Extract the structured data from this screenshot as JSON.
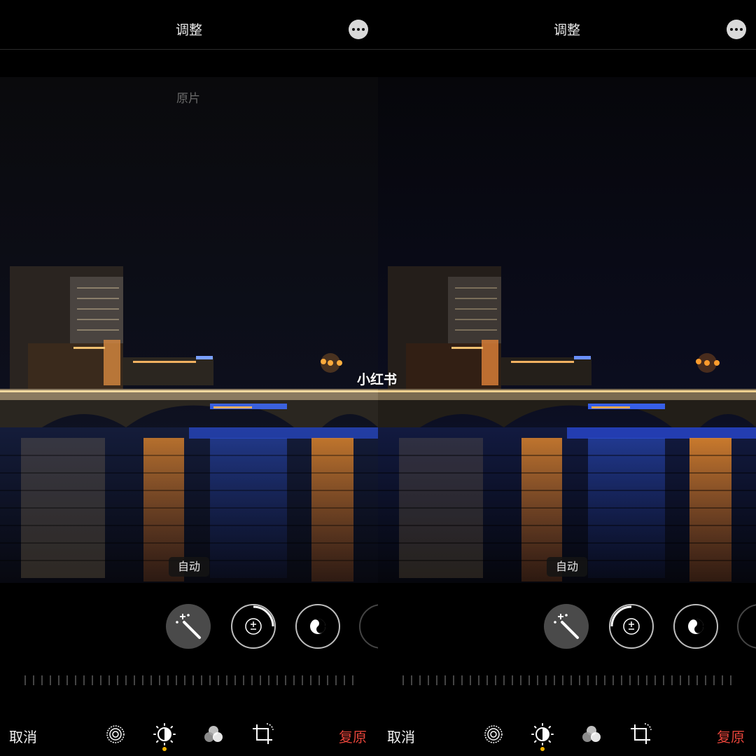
{
  "watermark": "小红书",
  "panes": [
    {
      "header": {
        "title": "调整"
      },
      "photo_overlay": "原片",
      "adjustment_label": "自动",
      "toolbar": {
        "cancel": "取消",
        "revert": "复原",
        "active_tab": "adjust"
      }
    },
    {
      "header": {
        "title": "调整"
      },
      "photo_overlay": "",
      "adjustment_label": "自动",
      "toolbar": {
        "cancel": "取消",
        "revert": "复原",
        "active_tab": "adjust"
      }
    }
  ],
  "colors": {
    "revert": "#e5443a",
    "active_dot": "#f2b400",
    "background": "#000000"
  },
  "icons": [
    "more-icon",
    "magic-wand-icon",
    "exposure-icon",
    "black-white-icon",
    "live-icon",
    "adjust-icon",
    "filters-icon",
    "crop-icon"
  ]
}
